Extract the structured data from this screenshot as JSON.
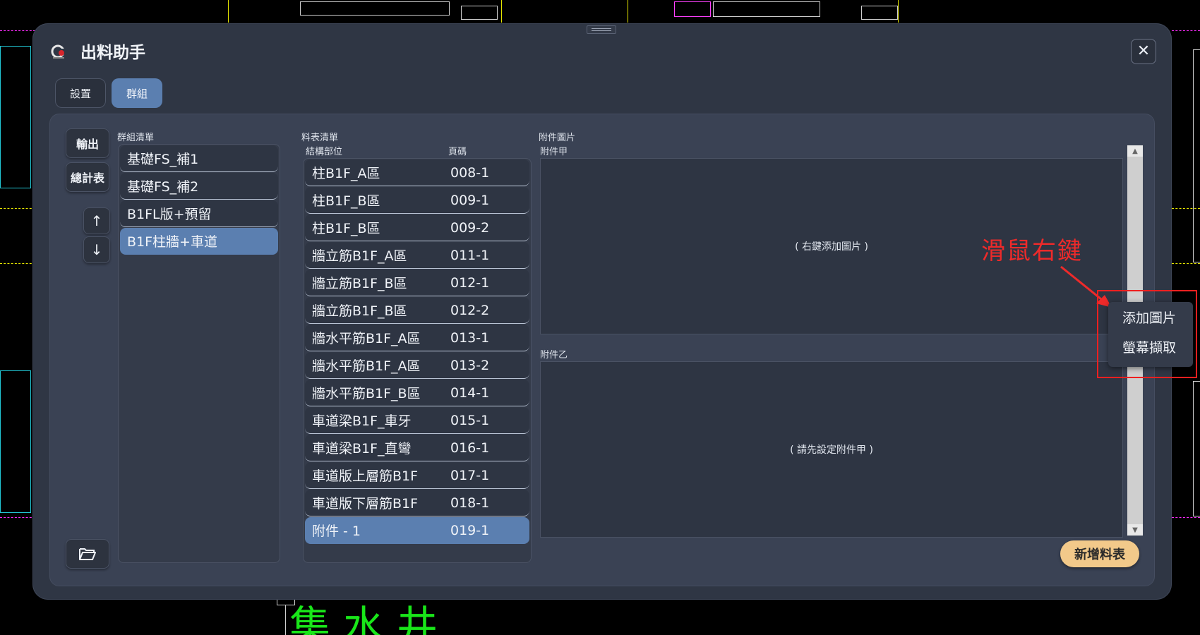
{
  "window": {
    "title": "出料助手",
    "close_glyph": "✕",
    "app_icon": "cad-logo-icon"
  },
  "tabs": [
    {
      "label": "設置",
      "active": false
    },
    {
      "label": "群組",
      "active": true
    }
  ],
  "side_buttons": {
    "export": "輸出",
    "summary": "總計表",
    "up": "↑",
    "down": "↓",
    "open_folder_icon": "folder-open-icon"
  },
  "group_list": {
    "label": "群組清單",
    "items": [
      {
        "name": "基礎FS_補1",
        "selected": false
      },
      {
        "name": "基礎FS_補2",
        "selected": false
      },
      {
        "name": "B1FL版+預留",
        "selected": false
      },
      {
        "name": "B1F柱牆+車道",
        "selected": true
      }
    ]
  },
  "sheet_list": {
    "label": "料表清單",
    "col_part": "結構部位",
    "col_page": "頁碼",
    "rows": [
      {
        "part": "柱B1F_A區",
        "page": "008-1",
        "selected": false
      },
      {
        "part": "柱B1F_B區",
        "page": "009-1",
        "selected": false
      },
      {
        "part": "柱B1F_B區",
        "page": "009-2",
        "selected": false
      },
      {
        "part": "牆立筋B1F_A區",
        "page": "011-1",
        "selected": false
      },
      {
        "part": "牆立筋B1F_B區",
        "page": "012-1",
        "selected": false
      },
      {
        "part": "牆立筋B1F_B區",
        "page": "012-2",
        "selected": false
      },
      {
        "part": "牆水平筋B1F_A區",
        "page": "013-1",
        "selected": false
      },
      {
        "part": "牆水平筋B1F_A區",
        "page": "013-2",
        "selected": false
      },
      {
        "part": "牆水平筋B1F_B區",
        "page": "014-1",
        "selected": false
      },
      {
        "part": "車道梁B1F_車牙",
        "page": "015-1",
        "selected": false
      },
      {
        "part": "車道梁B1F_直彎",
        "page": "016-1",
        "selected": false
      },
      {
        "part": "車道版上層筋B1F",
        "page": "017-1",
        "selected": false
      },
      {
        "part": "車道版下層筋B1F",
        "page": "018-1",
        "selected": false
      },
      {
        "part": "附件 - 1",
        "page": "019-1",
        "selected": true
      }
    ]
  },
  "attachments": {
    "label": "附件圖片",
    "a_label": "附件甲",
    "a_placeholder": "( 右鍵添加圖片 )",
    "b_label": "附件乙",
    "b_placeholder": "( 請先設定附件甲 )"
  },
  "add_sheet_button": "新增料表",
  "context_menu": {
    "items": [
      "添加圖片",
      "螢幕擷取"
    ]
  },
  "annotation": {
    "text": "滑鼠右鍵",
    "color": "#ee2a2a"
  },
  "cad_background_text": "集水井",
  "colors": {
    "accent": "#5b7fb0",
    "dialog_bg": "#2f3644",
    "panel_bg": "#3a4254",
    "button_gold": "#f2c98a"
  }
}
